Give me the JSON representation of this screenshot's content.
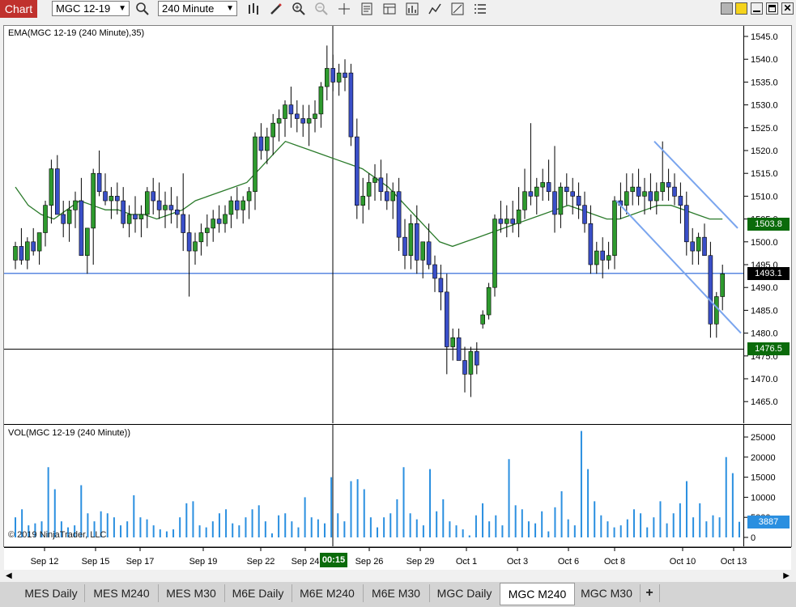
{
  "toolbar": {
    "chart_label": "Chart",
    "instrument": "MGC 12-19",
    "interval": "240 Minute"
  },
  "price_panel": {
    "indicator_label": "EMA(MGC 12-19 (240 Minute),35)",
    "axis_ticks": [
      "1545.0",
      "1540.0",
      "1535.0",
      "1530.0",
      "1525.0",
      "1520.0",
      "1515.0",
      "1510.0",
      "1505.0",
      "1500.0",
      "1495.0",
      "1490.0",
      "1485.0",
      "1480.0",
      "1475.0",
      "1470.0",
      "1465.0"
    ],
    "marker_ema": "1503.8",
    "marker_cursor": "1493.1",
    "marker_last": "1476.5",
    "colors": {
      "up": "#2e9a2e",
      "down": "#3a4fc8",
      "ema": "#2a7a2a",
      "trend": "#7aa5ee",
      "hline": "#5a88e0",
      "marker_green": "#0b6b0b"
    }
  },
  "volume_panel": {
    "indicator_label": "VOL(MGC 12-19 (240 Minute))",
    "axis_ticks": [
      "25000",
      "20000",
      "15000",
      "10000",
      "5000",
      "0"
    ],
    "marker_vol": "3887",
    "copyright": "© 2019 NinjaTrader, LLC",
    "bar_color": "#2a8fe0"
  },
  "x_axis": {
    "labels": [
      "Sep 12",
      "Sep 15",
      "Sep 17",
      "Sep 19",
      "Sep 22",
      "Sep 24",
      "Sep 26",
      "Sep 29",
      "Oct 1",
      "Oct 3",
      "Oct 6",
      "Oct 8",
      "Oct 10",
      "Oct 13"
    ],
    "cursor_time": "00:15"
  },
  "tabs": [
    {
      "label": "MES  Daily"
    },
    {
      "label": "MES  M240"
    },
    {
      "label": "MES  M30"
    },
    {
      "label": "M6E  Daily"
    },
    {
      "label": "M6E  M240"
    },
    {
      "label": "M6E  M30"
    },
    {
      "label": "MGC  Daily"
    },
    {
      "label": "MGC  M240",
      "active": true
    },
    {
      "label": "MGC M30"
    },
    {
      "label": "+"
    }
  ],
  "chart_data": {
    "type": "candlestick",
    "instrument": "MGC 12-19",
    "interval": "240 Minute",
    "ohlc": [
      [
        1496,
        1500,
        1494,
        1499
      ],
      [
        1499,
        1503,
        1495,
        1496
      ],
      [
        1496,
        1501,
        1494,
        1500
      ],
      [
        1500,
        1503,
        1497,
        1498
      ],
      [
        1498,
        1502,
        1495,
        1502
      ],
      [
        1502,
        1509,
        1499,
        1508
      ],
      [
        1508,
        1518,
        1504,
        1516
      ],
      [
        1516,
        1519,
        1508,
        1506
      ],
      [
        1506,
        1509,
        1501,
        1504
      ],
      [
        1504,
        1509,
        1500,
        1507
      ],
      [
        1507,
        1511,
        1503,
        1509
      ],
      [
        1509,
        1514,
        1499,
        1497
      ],
      [
        1497,
        1503,
        1493,
        1503
      ],
      [
        1503,
        1516,
        1495,
        1515
      ],
      [
        1515,
        1520,
        1510,
        1511
      ],
      [
        1511,
        1515,
        1508,
        1509
      ],
      [
        1509,
        1512,
        1505,
        1510
      ],
      [
        1510,
        1513,
        1506,
        1509
      ],
      [
        1509,
        1512,
        1503,
        1504
      ],
      [
        1504,
        1508,
        1501,
        1506
      ],
      [
        1506,
        1510,
        1502,
        1505
      ],
      [
        1505,
        1508,
        1501,
        1506
      ],
      [
        1506,
        1512,
        1503,
        1511
      ],
      [
        1511,
        1514,
        1506,
        1509
      ],
      [
        1509,
        1513,
        1505,
        1507
      ],
      [
        1507,
        1511,
        1503,
        1508
      ],
      [
        1508,
        1512,
        1504,
        1507
      ],
      [
        1507,
        1510,
        1503,
        1506
      ],
      [
        1506,
        1515,
        1498,
        1502
      ],
      [
        1502,
        1506,
        1488,
        1498
      ],
      [
        1498,
        1502,
        1495,
        1500
      ],
      [
        1500,
        1504,
        1497,
        1502
      ],
      [
        1502,
        1506,
        1499,
        1503
      ],
      [
        1503,
        1507,
        1500,
        1505
      ],
      [
        1505,
        1508,
        1502,
        1504
      ],
      [
        1504,
        1508,
        1502,
        1506
      ],
      [
        1506,
        1510,
        1503,
        1509
      ],
      [
        1509,
        1512,
        1505,
        1507
      ],
      [
        1507,
        1510,
        1504,
        1509
      ],
      [
        1509,
        1512,
        1505,
        1511
      ],
      [
        1511,
        1524,
        1507,
        1523
      ],
      [
        1523,
        1526,
        1518,
        1520
      ],
      [
        1520,
        1525,
        1517,
        1523
      ],
      [
        1523,
        1528,
        1519,
        1526
      ],
      [
        1526,
        1529,
        1522,
        1527
      ],
      [
        1527,
        1531,
        1523,
        1530
      ],
      [
        1530,
        1534,
        1525,
        1528
      ],
      [
        1528,
        1531,
        1524,
        1527
      ],
      [
        1527,
        1530,
        1523,
        1526
      ],
      [
        1526,
        1530,
        1521,
        1527
      ],
      [
        1527,
        1531,
        1524,
        1528
      ],
      [
        1528,
        1535,
        1525,
        1534
      ],
      [
        1534,
        1543,
        1531,
        1538
      ],
      [
        1538,
        1541,
        1533,
        1535
      ],
      [
        1535,
        1539,
        1532,
        1537
      ],
      [
        1537,
        1540,
        1533,
        1536
      ],
      [
        1537,
        1539,
        1521,
        1523
      ],
      [
        1523,
        1527,
        1505,
        1508
      ],
      [
        1508,
        1514,
        1504,
        1510
      ],
      [
        1510,
        1515,
        1507,
        1513
      ],
      [
        1513,
        1517,
        1509,
        1514
      ],
      [
        1514,
        1518,
        1509,
        1511
      ],
      [
        1511,
        1515,
        1507,
        1509
      ],
      [
        1509,
        1513,
        1505,
        1511
      ],
      [
        1511,
        1514,
        1498,
        1501
      ],
      [
        1501,
        1505,
        1494,
        1497
      ],
      [
        1497,
        1506,
        1494,
        1504
      ],
      [
        1504,
        1508,
        1493,
        1496
      ],
      [
        1496,
        1499,
        1492,
        1500
      ],
      [
        1500,
        1504,
        1494,
        1495
      ],
      [
        1495,
        1497,
        1489,
        1492
      ],
      [
        1492,
        1495,
        1485,
        1489
      ],
      [
        1489,
        1493,
        1471,
        1477
      ],
      [
        1477,
        1481,
        1474,
        1479
      ],
      [
        1479,
        1481,
        1475,
        1474
      ],
      [
        1474,
        1477,
        1467,
        1471
      ],
      [
        1471,
        1477,
        1466,
        1476
      ],
      [
        1476,
        1478,
        1471,
        1473
      ],
      [
        1482,
        1485,
        1481,
        1484
      ],
      [
        1484,
        1491,
        1483,
        1490
      ],
      [
        1490,
        1506,
        1488,
        1505
      ],
      [
        1505,
        1509,
        1502,
        1504
      ],
      [
        1504,
        1508,
        1501,
        1505
      ],
      [
        1505,
        1509,
        1502,
        1504
      ],
      [
        1504,
        1512,
        1501,
        1507
      ],
      [
        1507,
        1516,
        1505,
        1511
      ],
      [
        1511,
        1526,
        1508,
        1510
      ],
      [
        1510,
        1514,
        1506,
        1512
      ],
      [
        1512,
        1516,
        1509,
        1513
      ],
      [
        1513,
        1518,
        1509,
        1511
      ],
      [
        1511,
        1521,
        1502,
        1506
      ],
      [
        1506,
        1513,
        1503,
        1512
      ],
      [
        1512,
        1515,
        1508,
        1511
      ],
      [
        1511,
        1514,
        1506,
        1510
      ],
      [
        1510,
        1513,
        1505,
        1508
      ],
      [
        1508,
        1511,
        1502,
        1504
      ],
      [
        1504,
        1508,
        1493,
        1495
      ],
      [
        1495,
        1500,
        1493,
        1498
      ],
      [
        1498,
        1501,
        1492,
        1496
      ],
      [
        1496,
        1500,
        1494,
        1497
      ],
      [
        1497,
        1510,
        1494,
        1509
      ],
      [
        1509,
        1513,
        1505,
        1508
      ],
      [
        1508,
        1515,
        1506,
        1511
      ],
      [
        1511,
        1515,
        1508,
        1512
      ],
      [
        1512,
        1516,
        1508,
        1510
      ],
      [
        1510,
        1514,
        1506,
        1511
      ],
      [
        1511,
        1515,
        1507,
        1509
      ],
      [
        1509,
        1513,
        1506,
        1511
      ],
      [
        1511,
        1522,
        1509,
        1513
      ],
      [
        1513,
        1516,
        1509,
        1512
      ],
      [
        1512,
        1515,
        1508,
        1510
      ],
      [
        1510,
        1513,
        1504,
        1508
      ],
      [
        1508,
        1511,
        1497,
        1500
      ],
      [
        1500,
        1503,
        1495,
        1498
      ],
      [
        1498,
        1502,
        1495,
        1501
      ],
      [
        1501,
        1504,
        1497,
        1497
      ],
      [
        1497,
        1500,
        1479,
        1482
      ],
      [
        1482,
        1489,
        1479,
        1488
      ],
      [
        1488,
        1495,
        1485,
        1493
      ]
    ],
    "ema35": [
      1512,
      1508,
      1506,
      1505,
      1507,
      1509,
      1508,
      1507,
      1507,
      1506,
      1506,
      1505,
      1506,
      1507,
      1509,
      1510,
      1511,
      1512,
      1513,
      1516,
      1519,
      1522,
      1521,
      1520,
      1519,
      1518,
      1517,
      1516,
      1514,
      1512,
      1509,
      1506,
      1503,
      1500,
      1499,
      1500,
      1501,
      1502,
      1503,
      1504,
      1505,
      1506,
      1507,
      1508,
      1507,
      1506,
      1505,
      1505,
      1506,
      1507,
      1508,
      1508,
      1507,
      1506,
      1505,
      1505
    ],
    "volume": [
      5000,
      7000,
      3000,
      3500,
      4000,
      17500,
      12000,
      4000,
      2500,
      3000,
      13000,
      6000,
      4000,
      6500,
      6000,
      5000,
      3000,
      4000,
      10500,
      5000,
      4500,
      3000,
      2000,
      1500,
      2000,
      5000,
      8500,
      9000,
      3000,
      2500,
      4000,
      6000,
      7000,
      3500,
      3000,
      5000,
      7000,
      8000,
      4000,
      1000,
      5500,
      6000,
      4000,
      2500,
      10000,
      5000,
      4500,
      3500,
      15000,
      6000,
      4000,
      14000,
      14500,
      12000,
      5000,
      2500,
      5000,
      6000,
      9500,
      17500,
      6000,
      4500,
      3000,
      17000,
      6500,
      9500,
      4000,
      3000,
      2000,
      500,
      5500,
      8500,
      4000,
      5500,
      3000,
      19500,
      8000,
      7000,
      4000,
      3500,
      6500,
      1500,
      7500,
      11500,
      4500,
      3000,
      26500,
      17000,
      9000,
      5500,
      4000,
      2500,
      3000,
      4500,
      7000,
      6000,
      2500,
      5000,
      9000,
      3500,
      6000,
      8500,
      14000,
      5000,
      8500,
      4000,
      5500,
      5000,
      20000,
      16000,
      3887
    ],
    "x_labels": [
      "Sep 12",
      "Sep 15",
      "Sep 17",
      "Sep 19",
      "Sep 22",
      "Sep 24",
      "Sep 26",
      "Sep 29",
      "Oct 1",
      "Oct 3",
      "Oct 6",
      "Oct 8",
      "Oct 10",
      "Oct 13"
    ],
    "ylim_price": [
      1462,
      1548
    ],
    "ylim_volume": [
      0,
      27000
    ],
    "horizontal_lines": [
      1493.1,
      1476.5
    ],
    "trend_lines": [
      {
        "from": [
          "Oct 9",
          1522
        ],
        "to": [
          "Oct 13",
          1503
        ]
      },
      {
        "from": [
          "Oct 8",
          1509
        ],
        "to": [
          "Oct 13",
          1480
        ]
      }
    ],
    "grid": false
  }
}
